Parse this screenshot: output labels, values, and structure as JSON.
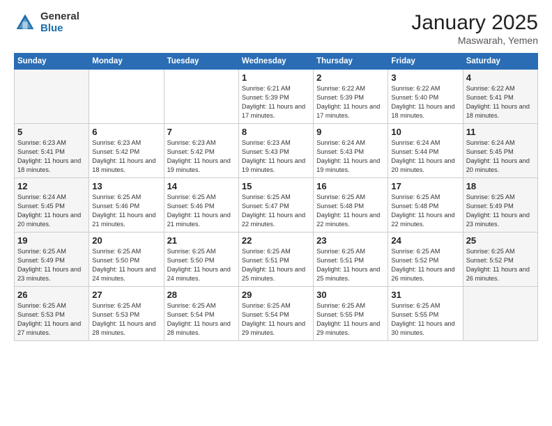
{
  "header": {
    "logo_general": "General",
    "logo_blue": "Blue",
    "month_title": "January 2025",
    "location": "Maswarah, Yemen"
  },
  "days_of_week": [
    "Sunday",
    "Monday",
    "Tuesday",
    "Wednesday",
    "Thursday",
    "Friday",
    "Saturday"
  ],
  "weeks": [
    [
      {
        "day": "",
        "info": ""
      },
      {
        "day": "",
        "info": ""
      },
      {
        "day": "",
        "info": ""
      },
      {
        "day": "1",
        "info": "Sunrise: 6:21 AM\nSunset: 5:39 PM\nDaylight: 11 hours and 17 minutes."
      },
      {
        "day": "2",
        "info": "Sunrise: 6:22 AM\nSunset: 5:39 PM\nDaylight: 11 hours and 17 minutes."
      },
      {
        "day": "3",
        "info": "Sunrise: 6:22 AM\nSunset: 5:40 PM\nDaylight: 11 hours and 18 minutes."
      },
      {
        "day": "4",
        "info": "Sunrise: 6:22 AM\nSunset: 5:41 PM\nDaylight: 11 hours and 18 minutes."
      }
    ],
    [
      {
        "day": "5",
        "info": "Sunrise: 6:23 AM\nSunset: 5:41 PM\nDaylight: 11 hours and 18 minutes."
      },
      {
        "day": "6",
        "info": "Sunrise: 6:23 AM\nSunset: 5:42 PM\nDaylight: 11 hours and 18 minutes."
      },
      {
        "day": "7",
        "info": "Sunrise: 6:23 AM\nSunset: 5:42 PM\nDaylight: 11 hours and 19 minutes."
      },
      {
        "day": "8",
        "info": "Sunrise: 6:23 AM\nSunset: 5:43 PM\nDaylight: 11 hours and 19 minutes."
      },
      {
        "day": "9",
        "info": "Sunrise: 6:24 AM\nSunset: 5:43 PM\nDaylight: 11 hours and 19 minutes."
      },
      {
        "day": "10",
        "info": "Sunrise: 6:24 AM\nSunset: 5:44 PM\nDaylight: 11 hours and 20 minutes."
      },
      {
        "day": "11",
        "info": "Sunrise: 6:24 AM\nSunset: 5:45 PM\nDaylight: 11 hours and 20 minutes."
      }
    ],
    [
      {
        "day": "12",
        "info": "Sunrise: 6:24 AM\nSunset: 5:45 PM\nDaylight: 11 hours and 20 minutes."
      },
      {
        "day": "13",
        "info": "Sunrise: 6:25 AM\nSunset: 5:46 PM\nDaylight: 11 hours and 21 minutes."
      },
      {
        "day": "14",
        "info": "Sunrise: 6:25 AM\nSunset: 5:46 PM\nDaylight: 11 hours and 21 minutes."
      },
      {
        "day": "15",
        "info": "Sunrise: 6:25 AM\nSunset: 5:47 PM\nDaylight: 11 hours and 22 minutes."
      },
      {
        "day": "16",
        "info": "Sunrise: 6:25 AM\nSunset: 5:48 PM\nDaylight: 11 hours and 22 minutes."
      },
      {
        "day": "17",
        "info": "Sunrise: 6:25 AM\nSunset: 5:48 PM\nDaylight: 11 hours and 22 minutes."
      },
      {
        "day": "18",
        "info": "Sunrise: 6:25 AM\nSunset: 5:49 PM\nDaylight: 11 hours and 23 minutes."
      }
    ],
    [
      {
        "day": "19",
        "info": "Sunrise: 6:25 AM\nSunset: 5:49 PM\nDaylight: 11 hours and 23 minutes."
      },
      {
        "day": "20",
        "info": "Sunrise: 6:25 AM\nSunset: 5:50 PM\nDaylight: 11 hours and 24 minutes."
      },
      {
        "day": "21",
        "info": "Sunrise: 6:25 AM\nSunset: 5:50 PM\nDaylight: 11 hours and 24 minutes."
      },
      {
        "day": "22",
        "info": "Sunrise: 6:25 AM\nSunset: 5:51 PM\nDaylight: 11 hours and 25 minutes."
      },
      {
        "day": "23",
        "info": "Sunrise: 6:25 AM\nSunset: 5:51 PM\nDaylight: 11 hours and 25 minutes."
      },
      {
        "day": "24",
        "info": "Sunrise: 6:25 AM\nSunset: 5:52 PM\nDaylight: 11 hours and 26 minutes."
      },
      {
        "day": "25",
        "info": "Sunrise: 6:25 AM\nSunset: 5:52 PM\nDaylight: 11 hours and 26 minutes."
      }
    ],
    [
      {
        "day": "26",
        "info": "Sunrise: 6:25 AM\nSunset: 5:53 PM\nDaylight: 11 hours and 27 minutes."
      },
      {
        "day": "27",
        "info": "Sunrise: 6:25 AM\nSunset: 5:53 PM\nDaylight: 11 hours and 28 minutes."
      },
      {
        "day": "28",
        "info": "Sunrise: 6:25 AM\nSunset: 5:54 PM\nDaylight: 11 hours and 28 minutes."
      },
      {
        "day": "29",
        "info": "Sunrise: 6:25 AM\nSunset: 5:54 PM\nDaylight: 11 hours and 29 minutes."
      },
      {
        "day": "30",
        "info": "Sunrise: 6:25 AM\nSunset: 5:55 PM\nDaylight: 11 hours and 29 minutes."
      },
      {
        "day": "31",
        "info": "Sunrise: 6:25 AM\nSunset: 5:55 PM\nDaylight: 11 hours and 30 minutes."
      },
      {
        "day": "",
        "info": ""
      }
    ]
  ]
}
